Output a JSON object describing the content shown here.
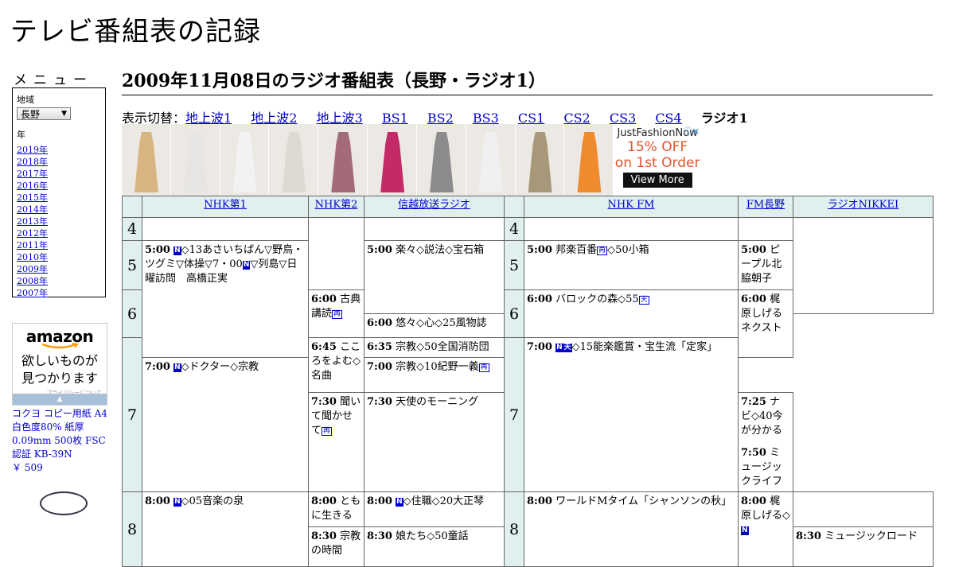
{
  "site": {
    "title": "テレビ番組表の記録"
  },
  "menu": {
    "label": "メニュー",
    "region_label": "地域",
    "region_value": "長野",
    "year_label": "年",
    "years": [
      "2019年",
      "2018年",
      "2017年",
      "2016年",
      "2015年",
      "2014年",
      "2013年",
      "2012年",
      "2011年",
      "2010年",
      "2009年",
      "2008年",
      "2007年"
    ]
  },
  "amazon_ad": {
    "logo": "amazon",
    "tagline_1": "欲しいものが",
    "tagline_2": "見つかります",
    "privacy": "プライバシーについて"
  },
  "product": {
    "name": "コクヨ コピー用紙 A4 白色度80% 紙厚0.09mm 500枚 FSC認証 KB-39N",
    "price": "￥ 509"
  },
  "page": {
    "heading": "2009年11月08日のラジオ番組表（長野・ラジオ1）"
  },
  "switcher": {
    "label": "表示切替：",
    "links": [
      "地上波1",
      "地上波2",
      "地上波3",
      "BS1",
      "BS2",
      "BS3",
      "CS1",
      "CS2",
      "CS3",
      "CS4"
    ],
    "current": "ラジオ1"
  },
  "display_ad": {
    "brand": "JustFashionNow",
    "offer_1": "15% OFF",
    "offer_2": "on 1st Order",
    "button": "View More",
    "thumb_colors": [
      "#d9b483",
      "#e8e6e4",
      "#f2f2f2",
      "#dedad2",
      "#a36b79",
      "#c42a68",
      "#8c8c8c",
      "#f0f0f0",
      "#a69879",
      "#f08a2e"
    ]
  },
  "schedule": {
    "channels": [
      "NHK第1",
      "NHK第2",
      "信越放送ラジオ",
      "NHK FM",
      "FM長野",
      "ラジオNIKKEI"
    ],
    "hours": [
      "4",
      "5",
      "6",
      "7",
      "8"
    ],
    "programs": {
      "nhk1_500": {
        "time": "5:00",
        "pre": "",
        "text": "◇13あさいちばん▽野鳥・ツグミ▽体操▽7・00",
        "tail": "▽列島▽日曜訪問　高橋正実"
      },
      "nhk1_800": {
        "time": "8:00",
        "text": "◇05音楽の泉"
      },
      "nhk2_600": {
        "time": "6:00",
        "text": "古典講読"
      },
      "nhk2_645": {
        "time": "6:45",
        "text": "こころをよむ◇名曲"
      },
      "nhk2_730": {
        "time": "7:30",
        "text": "聞いて聞かせて"
      },
      "nhk2_800": {
        "time": "8:00",
        "text": "ともに生きる"
      },
      "nhk2_830": {
        "time": "8:30",
        "text": "宗教の時間"
      },
      "sbc_500": {
        "time": "5:00",
        "text": "楽々◇説法◇宝石箱"
      },
      "sbc_600": {
        "time": "6:00",
        "text": "悠々◇心◇25風物誌"
      },
      "sbc_635": {
        "time": "6:35",
        "text": "宗教◇50全国消防団"
      },
      "sbc_700": {
        "time": "7:00",
        "text": "◇ドクター◇宗教"
      },
      "sbc_800": {
        "time": "8:00",
        "text": "◇住職◇20大正琴"
      },
      "sbc_830": {
        "time": "8:30",
        "text": "娘たち◇50童話"
      },
      "fm_500": {
        "time": "5:00",
        "text": "邦楽百番",
        "tail": "◇50小箱"
      },
      "fm_600": {
        "time": "6:00",
        "text": "バロックの森◇55"
      },
      "fm_700": {
        "time": "7:00",
        "text": "◇15能楽鑑賞・宝生流「定家」"
      },
      "fm_800": {
        "time": "8:00",
        "text": "ワールドMタイム「シャンソンの秋」"
      },
      "fmn_500": {
        "time": "5:00",
        "text": "ピープル北脇朝子"
      },
      "fmn_600": {
        "time": "6:00",
        "text": "梶原しげるネクスト"
      },
      "fmn_730": {
        "time": "7:30",
        "text": "天使のモーニング"
      },
      "fmn_800": {
        "time": "8:00",
        "text": "梶原しげる◇"
      },
      "nik_700": {
        "time": "7:00",
        "text": "宗教◇10紀野一義"
      },
      "nik_725": {
        "time": "7:25",
        "text": "ナビ◇40今が分かる"
      },
      "nik_750": {
        "time": "7:50",
        "text": "ミュージックライフ"
      },
      "nik_830": {
        "time": "8:30",
        "text": "ミュージックロード"
      }
    },
    "icons": {
      "news": "N",
      "stereo": "再",
      "ten": "天"
    }
  }
}
